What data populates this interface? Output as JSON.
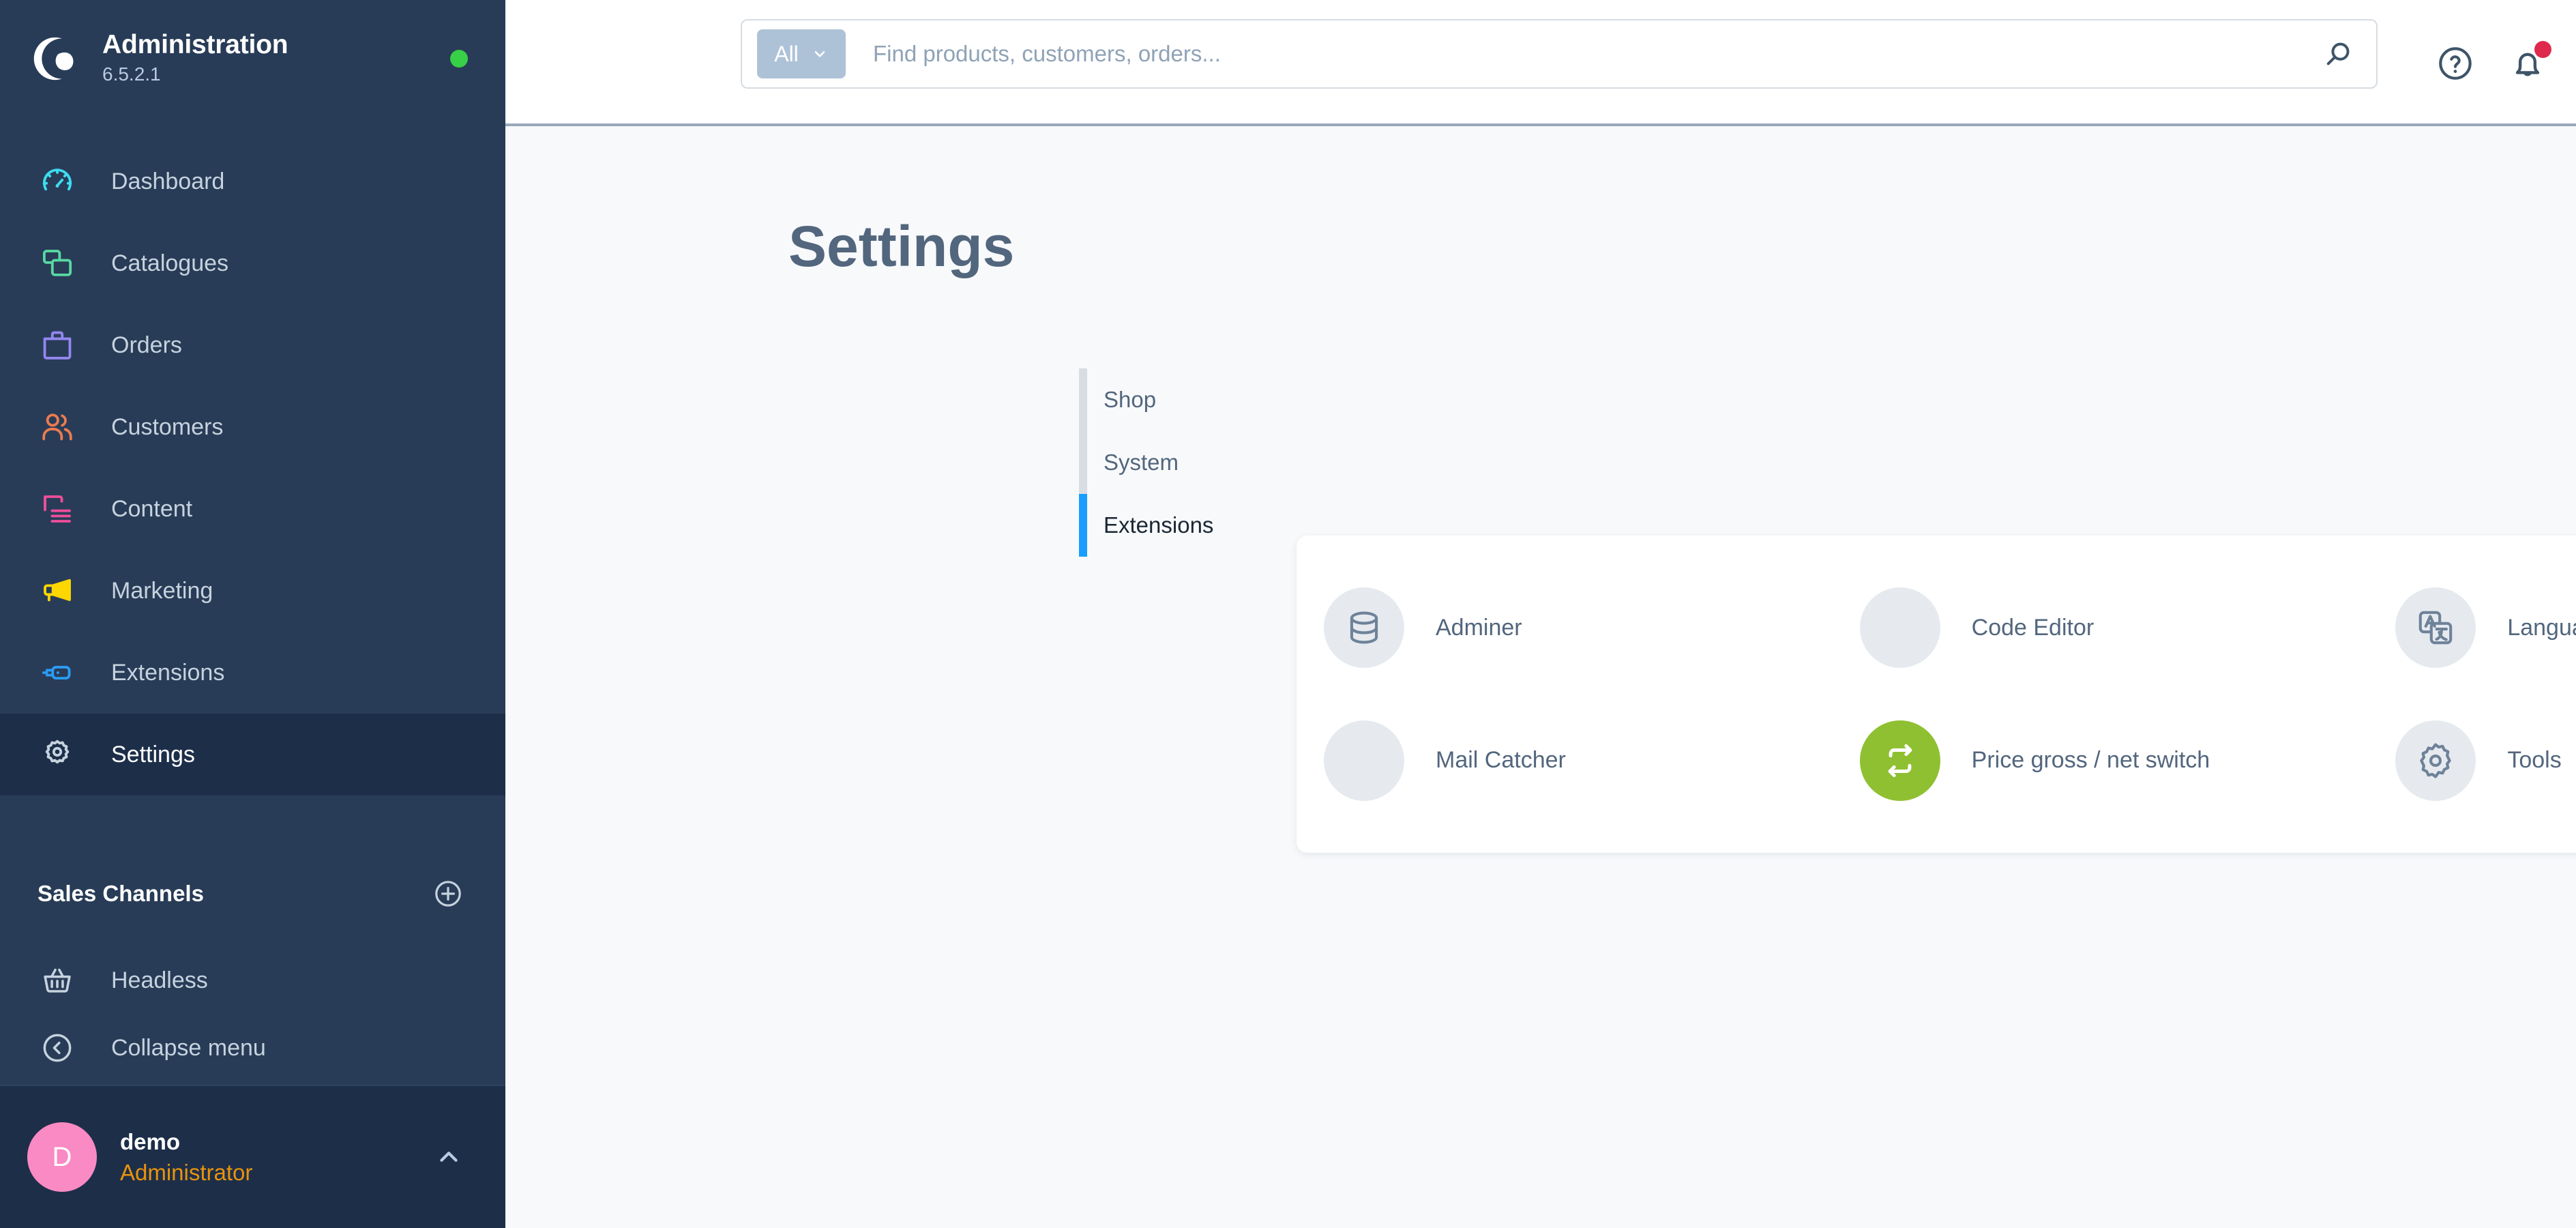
{
  "sidebar": {
    "brand": {
      "title": "Administration",
      "version": "6.5.2.1",
      "status_icon": "status-dot-online",
      "status_color": "#37d046",
      "logo_icon": "shopware-logo-icon"
    },
    "nav": [
      {
        "label": "Dashboard",
        "icon": "dashboard-icon",
        "color": "#3edbf0",
        "active": false
      },
      {
        "label": "Catalogues",
        "icon": "catalogues-icon",
        "color": "#58d8a3",
        "active": false
      },
      {
        "label": "Orders",
        "icon": "orders-icon",
        "color": "#9486f0",
        "active": false
      },
      {
        "label": "Customers",
        "icon": "customers-icon",
        "color": "#ec7b50",
        "active": false
      },
      {
        "label": "Content",
        "icon": "content-icon",
        "color": "#ee4e9b",
        "active": false
      },
      {
        "label": "Marketing",
        "icon": "marketing-icon",
        "color": "#ffd700",
        "active": false
      },
      {
        "label": "Extensions",
        "icon": "extensions-icon",
        "color": "#2b9bf3",
        "active": false
      },
      {
        "label": "Settings",
        "icon": "settings-gear-icon",
        "color": "#c6d2de",
        "active": true
      }
    ],
    "sales_channels": {
      "title": "Sales Channels",
      "add_icon": "plus-circle-icon",
      "items": [
        {
          "label": "Headless",
          "icon": "basket-icon"
        }
      ]
    },
    "collapse": {
      "label": "Collapse menu",
      "icon": "chevron-left-circle-icon"
    },
    "user": {
      "avatar_initial": "D",
      "avatar_color": "#f98ac3",
      "name": "demo",
      "role": "Administrator",
      "role_color": "#e9930c",
      "chevron_icon": "chevron-up-icon"
    }
  },
  "header": {
    "search": {
      "scope_label": "All",
      "scope_chevron_icon": "chevron-down-icon",
      "placeholder": "Find products, customers, orders...",
      "value": "",
      "submit_icon": "search-icon"
    },
    "actions": [
      {
        "name": "help-button",
        "icon": "question-circle-icon",
        "badge": false
      },
      {
        "name": "notifications-button",
        "icon": "bell-icon",
        "badge": true,
        "badge_color": "#de294c"
      }
    ]
  },
  "main": {
    "page_title": "Settings",
    "tabs": [
      {
        "label": "Shop",
        "active": false
      },
      {
        "label": "System",
        "active": false
      },
      {
        "label": "Extensions",
        "active": true
      }
    ],
    "active_tab_color": "#189eff",
    "extensions": [
      {
        "label": "Adminer",
        "icon": "database-icon",
        "avatar_style": "grey"
      },
      {
        "label": "Code Editor",
        "icon": "none",
        "avatar_style": "blank"
      },
      {
        "label": "Language pack",
        "icon": "translate-icon",
        "avatar_style": "grey"
      },
      {
        "label": "Mail Catcher",
        "icon": "none",
        "avatar_style": "blank"
      },
      {
        "label": "Price gross / net switch",
        "icon": "repeat-icon",
        "avatar_style": "green"
      },
      {
        "label": "Tools",
        "icon": "gear-icon",
        "avatar_style": "grey"
      }
    ]
  }
}
